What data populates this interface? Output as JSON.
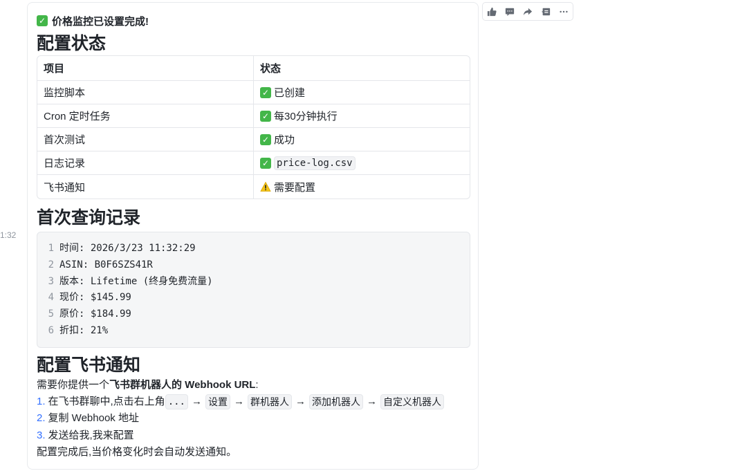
{
  "timestamp": "1:32",
  "message": {
    "heading": "价格监控已设置完成!",
    "config_title": "配置状态",
    "table": {
      "headers": [
        "项目",
        "状态"
      ],
      "rows": [
        {
          "item": "监控脚本",
          "status": "已创建",
          "icon": "check-icon"
        },
        {
          "item": "Cron 定时任务",
          "status": "每30分钟执行",
          "icon": "check-icon"
        },
        {
          "item": "首次测试",
          "status": "成功",
          "icon": "check-icon"
        },
        {
          "item": "日志记录",
          "status": "price-log.csv",
          "icon": "check-icon"
        },
        {
          "item": "飞书通知",
          "status": "需要配置",
          "icon": "warning-icon"
        }
      ]
    },
    "first_query_title": "首次查询记录",
    "code_lines": [
      {
        "n": "1",
        "text": "时间: 2026/3/23 11:32:29"
      },
      {
        "n": "2",
        "text": "ASIN: B0F6SZS41R"
      },
      {
        "n": "3",
        "text": "版本: Lifetime (终身免费流量)"
      },
      {
        "n": "4",
        "text": "现价: $145.99"
      },
      {
        "n": "5",
        "text": "原价: $184.99"
      },
      {
        "n": "6",
        "text": "折扣: 21%"
      }
    ],
    "feishu_title": "配置飞书通知",
    "intro_prefix": "需要你提供一个",
    "intro_bold": "飞书群机器人的 Webhook URL",
    "intro_suffix": ":",
    "steps": {
      "step1_num": "1.",
      "step1_text": "在飞书群聊中,点击右上角",
      "step1_chips": [
        "...",
        "设置",
        "群机器人",
        "添加机器人",
        "自定义机器人"
      ],
      "arrow": "→",
      "step2_num": "2.",
      "step2_text": "复制 Webhook 地址",
      "step3_num": "3.",
      "step3_text": "发送给我,我来配置"
    },
    "outro": "配置完成后,当价格变化时会自动发送通知。"
  },
  "actions": [
    {
      "name": "thumbs-up-icon"
    },
    {
      "name": "comment-icon"
    },
    {
      "name": "forward-icon"
    },
    {
      "name": "quote-reply-icon"
    },
    {
      "name": "more-icon"
    }
  ],
  "colors": {
    "accent": "#3370ff",
    "check": "#43b649",
    "warning": "#f5c518"
  }
}
